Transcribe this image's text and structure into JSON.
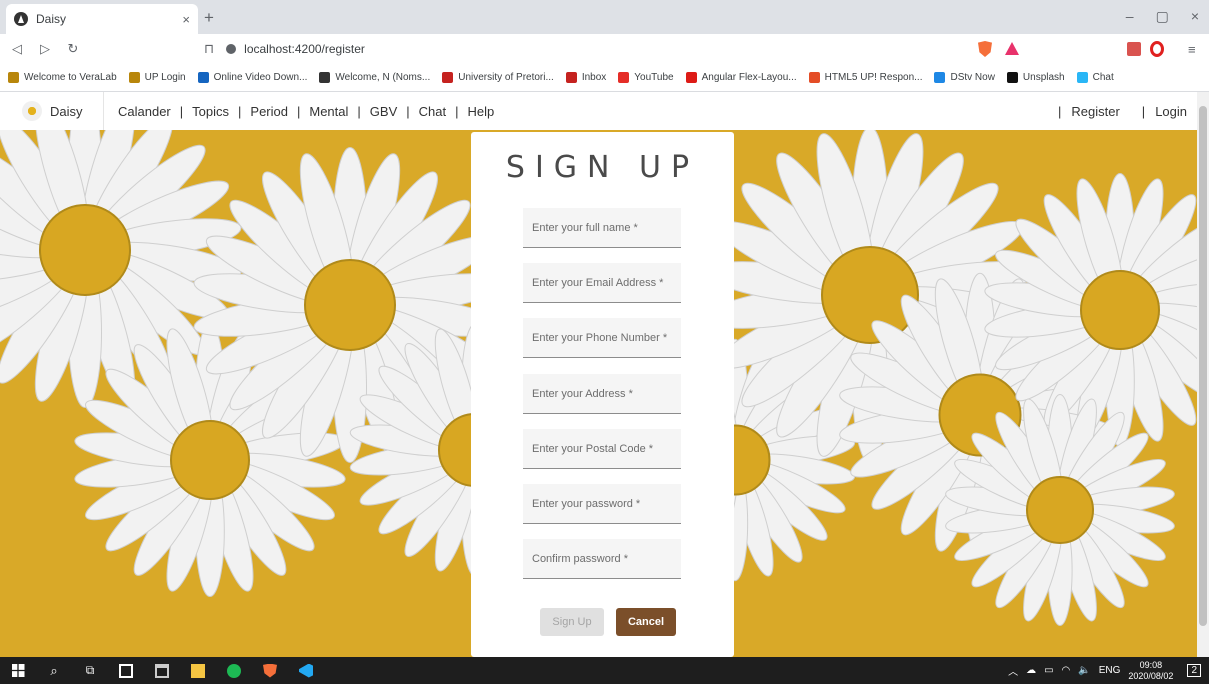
{
  "browser": {
    "tab_title": "Daisy",
    "tab_close": "×",
    "new_tab": "+",
    "url": "localhost:4200/register",
    "window_controls": [
      "–",
      "▢",
      "×"
    ],
    "bookmarks": [
      {
        "label": "Welcome to VeraLab",
        "icon": "veralab-icon",
        "color": "#b8860b"
      },
      {
        "label": "UP Login",
        "icon": "up-icon",
        "color": "#b8860b"
      },
      {
        "label": "Online Video Down...",
        "icon": "video-icon",
        "color": "#1565c0"
      },
      {
        "label": "Welcome, N (Noms...",
        "icon": "welcome-icon",
        "color": "#333333"
      },
      {
        "label": "University of Pretori...",
        "icon": "gmail-icon",
        "color": "#c5221f"
      },
      {
        "label": "Inbox",
        "icon": "gmail-icon",
        "color": "#c5221f"
      },
      {
        "label": "YouTube",
        "icon": "youtube-icon",
        "color": "#e52d27"
      },
      {
        "label": "Angular Flex-Layou...",
        "icon": "angular-icon",
        "color": "#dd1b16"
      },
      {
        "label": "HTML5 UP! Respon...",
        "icon": "html5up-icon",
        "color": "#e44d26"
      },
      {
        "label": "DStv Now",
        "icon": "dstv-icon",
        "color": "#1e88e5"
      },
      {
        "label": "Unsplash",
        "icon": "unsplash-icon",
        "color": "#111111"
      },
      {
        "label": "Chat",
        "icon": "chat-icon",
        "color": "#29b6f6"
      }
    ]
  },
  "app": {
    "brand": "Daisy",
    "nav": [
      "Calander",
      "Topics",
      "Period",
      "Mental",
      "GBV",
      "Chat",
      "Help"
    ],
    "register": "Register",
    "login": "Login"
  },
  "form": {
    "title": "SIGN UP",
    "fields": [
      {
        "placeholder": "Enter your full name *"
      },
      {
        "placeholder": "Enter your Email Address *"
      },
      {
        "placeholder": "Enter your Phone Number *"
      },
      {
        "placeholder": "Enter your Address *"
      },
      {
        "placeholder": "Enter your Postal Code *"
      },
      {
        "placeholder": "Enter your password *"
      },
      {
        "placeholder": "Confirm password *"
      }
    ],
    "signup_label": "Sign Up",
    "cancel_label": "Cancel"
  },
  "taskbar": {
    "lang": "ENG",
    "time": "09:08",
    "date": "2020/08/02",
    "notifications": "2"
  },
  "colors": {
    "background": "#d9a928",
    "cancel_button": "#7b4f2a",
    "petal": "#f2f2f2",
    "center": "#d8a722"
  }
}
